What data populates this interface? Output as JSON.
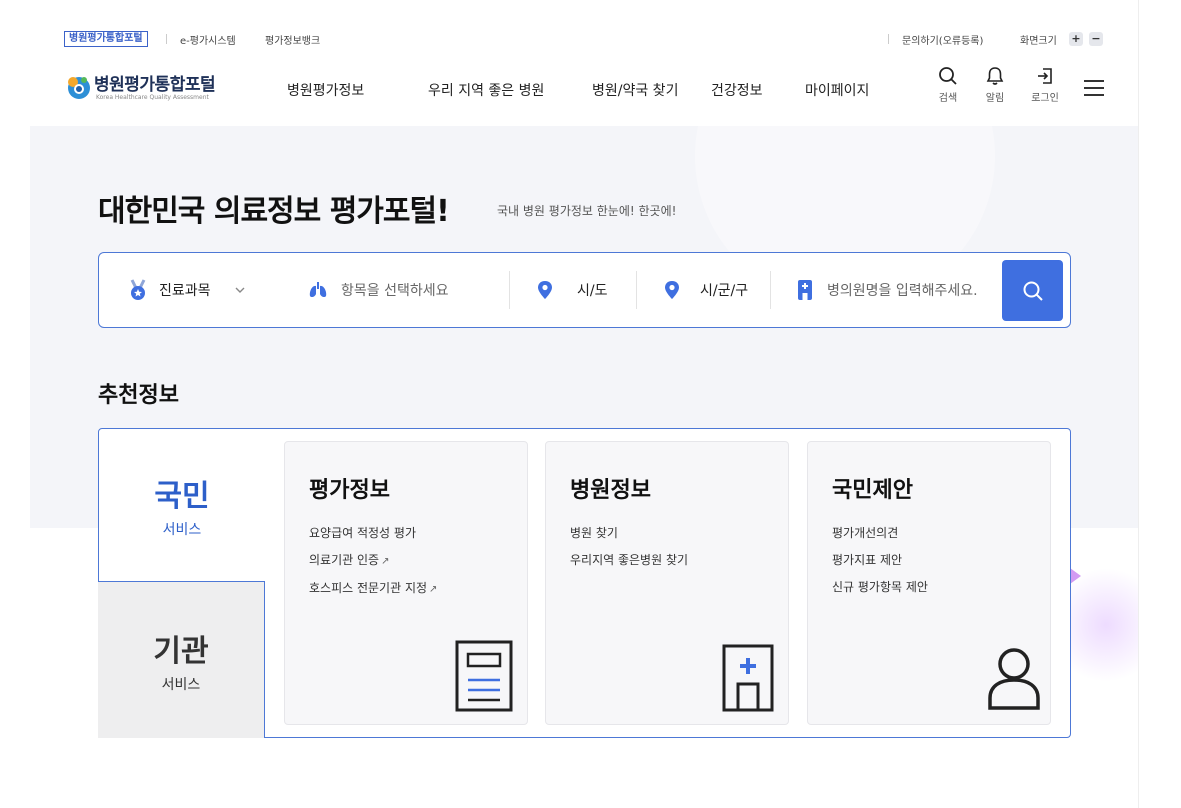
{
  "utility": {
    "links": [
      "병원평가통합포털",
      "e-평가시스템",
      "평가정보뱅크"
    ],
    "inquiry": "문의하기(오류등록)",
    "screen_size": "화면크기",
    "zoom_in": "+",
    "zoom_out": "−"
  },
  "logo": {
    "title": "병원평가통합포털",
    "subtitle": "Korea Healthcare Quality Assessment"
  },
  "gnb": [
    "병원평가정보",
    "우리 지역 좋은 병원",
    "병원/약국 찾기",
    "건강정보",
    "마이페이지"
  ],
  "icons": [
    {
      "label": "검색",
      "icon": "search-icon"
    },
    {
      "label": "알림",
      "icon": "bell-icon"
    },
    {
      "label": "로그인",
      "icon": "login-icon"
    }
  ],
  "hero": {
    "title": "대한민국 의료정보 평가포털!",
    "subtitle": "국내 병원 평가정보 한눈에! 한곳에!"
  },
  "search": {
    "department": "진료과목",
    "item_placeholder": "항목을 선택하세요",
    "sido": "시/도",
    "sigungu": "시/군/구",
    "hospital_placeholder": "병의원명을 입력해주세요."
  },
  "recommend": {
    "title": "추천정보",
    "tabs": [
      {
        "big": "국민",
        "small": "서비스"
      },
      {
        "big": "기관",
        "small": "서비스"
      }
    ],
    "cards": [
      {
        "title": "평가정보",
        "items": [
          "요양급여 적정성 평가",
          "의료기관 인증",
          "호스피스 전문기관 지정"
        ],
        "icon": "document-icon"
      },
      {
        "title": "병원정보",
        "items": [
          "병원 찾기",
          "우리지역 좋은병원 찾기"
        ],
        "icon": "hospital-icon"
      },
      {
        "title": "국민제안",
        "items": [
          "평가개선의견",
          "평가지표 제안",
          "신규 평가항목 제안"
        ],
        "icon": "person-icon"
      }
    ]
  },
  "colors": {
    "accent": "#3f6fe0",
    "border": "#4d78d6",
    "hero_bg": "#f4f5f9"
  }
}
